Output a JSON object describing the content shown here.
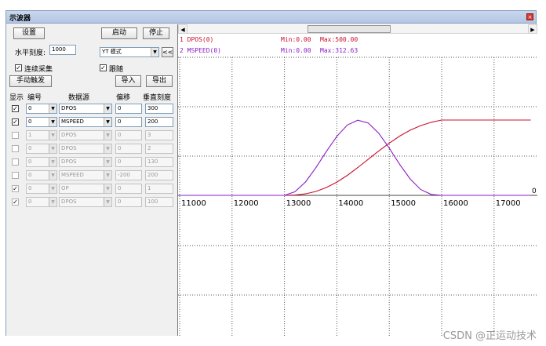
{
  "window": {
    "title": "示波器",
    "close": "×"
  },
  "controls": {
    "settings_button": "设置",
    "start_button": "启动",
    "stop_button": "停止",
    "h_scale_label": "水平刻度:",
    "h_scale_value": "1000",
    "mode_value": "YT 模式",
    "collapse_button": "<<",
    "continuous_label": "连续采集",
    "follow_label": "跟随",
    "manual_trigger_button": "手动触发",
    "import_button": "导入",
    "export_button": "导出"
  },
  "table": {
    "headers": [
      "显示",
      "编号",
      "数据源",
      "偏移",
      "垂直刻度"
    ],
    "rows": [
      {
        "checked": true,
        "num": "0",
        "source": "DPOS",
        "offset": "0",
        "scale": "300",
        "enabled": true
      },
      {
        "checked": true,
        "num": "0",
        "source": "MSPEED",
        "offset": "0",
        "scale": "200",
        "enabled": true
      },
      {
        "checked": false,
        "num": "1",
        "source": "DPOS",
        "offset": "0",
        "scale": "3",
        "enabled": false
      },
      {
        "checked": false,
        "num": "0",
        "source": "DPOS",
        "offset": "0",
        "scale": "2",
        "enabled": false
      },
      {
        "checked": false,
        "num": "0",
        "source": "DPOS",
        "offset": "0",
        "scale": "130",
        "enabled": false
      },
      {
        "checked": false,
        "num": "0",
        "source": "MSPEED",
        "offset": "-200",
        "scale": "200",
        "enabled": false
      },
      {
        "checked": true,
        "num": "0",
        "source": "OP",
        "offset": "0",
        "scale": "1",
        "enabled": false
      },
      {
        "checked": true,
        "num": "0",
        "source": "DPOS",
        "offset": "0",
        "scale": "100",
        "enabled": false
      }
    ]
  },
  "chart_data": {
    "type": "line",
    "x_ticks": [
      "11000",
      "12000",
      "13000",
      "14000",
      "15000",
      "16000",
      "17000"
    ],
    "x_range": [
      11000,
      17700
    ],
    "zero_label": "0",
    "series": [
      {
        "name": "1 DPOS(0)",
        "min_label": "Min:0.00",
        "max_label": "Max:500.00",
        "color": "#c8102e",
        "x": [
          11000,
          13000,
          13200,
          13400,
          13600,
          13800,
          14000,
          14200,
          14400,
          14600,
          14800,
          15000,
          15200,
          15400,
          15600,
          15800,
          16000,
          17700
        ],
        "y": [
          0,
          0,
          2,
          10,
          26,
          52,
          88,
          133,
          185,
          240,
          295,
          347,
          394,
          433,
          463,
          485,
          500,
          500
        ]
      },
      {
        "name": "2 MSPEED(0)",
        "min_label": "Min:0.00",
        "max_label": "Max:312.63",
        "color": "#8a1cc4",
        "x": [
          11000,
          13000,
          13200,
          13400,
          13600,
          13800,
          14000,
          14200,
          14400,
          14600,
          14800,
          15000,
          15200,
          15400,
          15600,
          15800,
          16000,
          17700
        ],
        "y": [
          0,
          0,
          15,
          55,
          115,
          182,
          245,
          292,
          312,
          300,
          258,
          196,
          128,
          68,
          24,
          4,
          0,
          0
        ]
      }
    ]
  },
  "watermark": "CSDN @正运动技术"
}
